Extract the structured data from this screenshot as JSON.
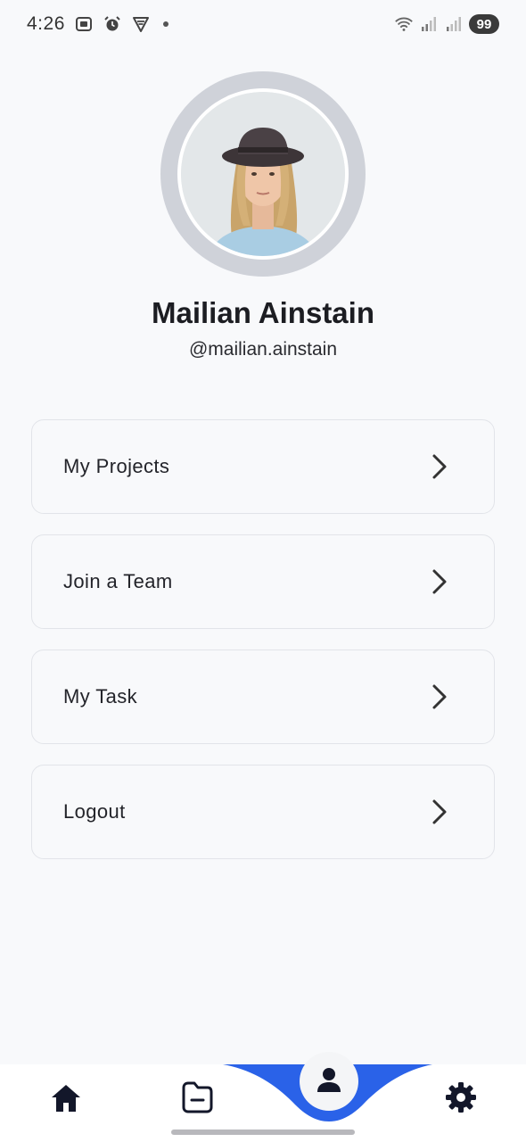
{
  "status_bar": {
    "time": "4:26",
    "battery": "99",
    "icons": [
      "screenshot-icon",
      "alarm-icon",
      "vpn-icon",
      "notification-dot",
      "wifi-icon",
      "signal-icon",
      "signal-icon"
    ]
  },
  "profile": {
    "name": "Mailian Ainstain",
    "handle": "@mailian.ainstain",
    "avatar_icon": "user-photo"
  },
  "menu": {
    "items": [
      {
        "label": "My Projects",
        "icon": "chevron-right-icon"
      },
      {
        "label": "Join a Team",
        "icon": "chevron-right-icon"
      },
      {
        "label": "My Task",
        "icon": "chevron-right-icon"
      },
      {
        "label": "Logout",
        "icon": "chevron-right-icon"
      }
    ]
  },
  "bottom_nav": {
    "items": [
      "home-icon",
      "folder-icon",
      "profile-icon",
      "settings-icon"
    ],
    "active": "profile-icon",
    "accent_color": "#2a62e8"
  }
}
